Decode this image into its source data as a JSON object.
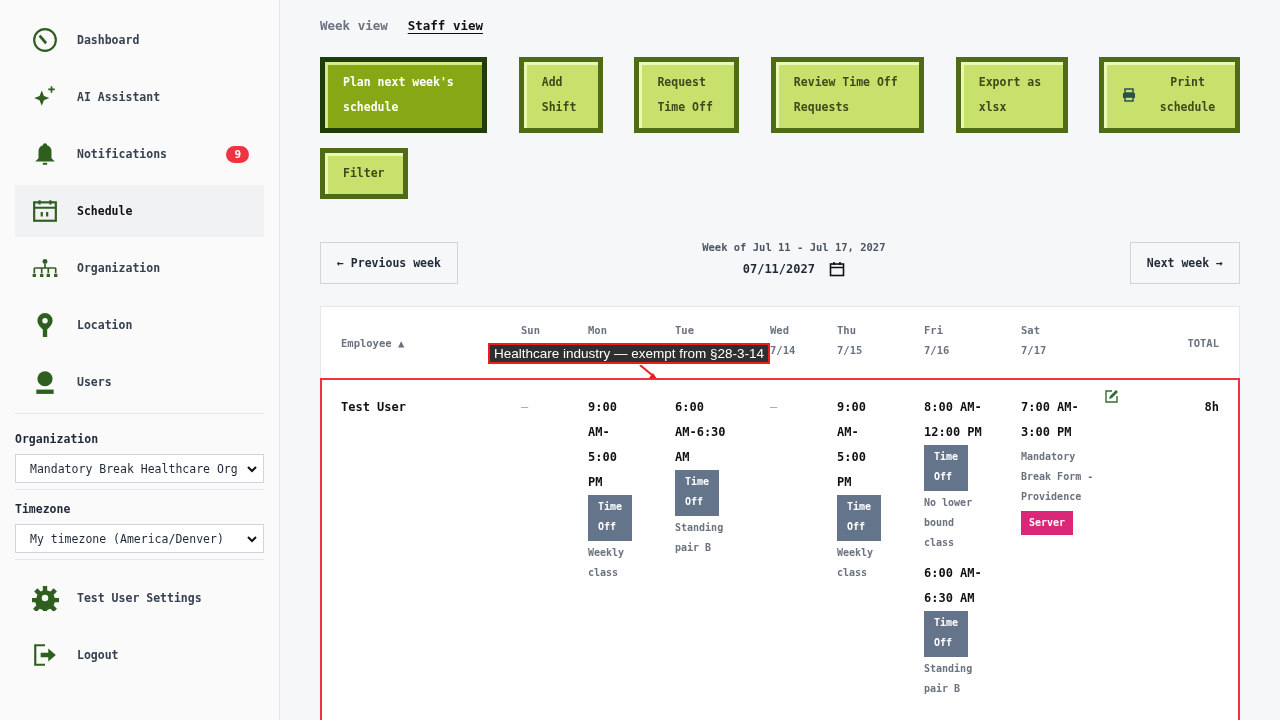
{
  "sidebar": {
    "items": [
      {
        "label": "Dashboard",
        "selected": false
      },
      {
        "label": "AI Assistant",
        "selected": false
      },
      {
        "label": "Notifications",
        "selected": false,
        "badge": "9"
      },
      {
        "label": "Schedule",
        "selected": true
      },
      {
        "label": "Organization",
        "selected": false
      },
      {
        "label": "Location",
        "selected": false
      },
      {
        "label": "Users",
        "selected": false
      }
    ],
    "selects": [
      {
        "label": "Organization",
        "value": "Mandatory Break Healthcare Org"
      },
      {
        "label": "Timezone",
        "value": "My timezone (America/Denver)"
      }
    ],
    "footer_items": [
      {
        "label": "Test User Settings"
      },
      {
        "label": "Logout"
      }
    ]
  },
  "view_tabs": [
    {
      "label": "Week view",
      "selected": false
    },
    {
      "label": "Staff view",
      "selected": true
    }
  ],
  "actions": [
    {
      "label": "Plan next week's schedule",
      "kind": "primary"
    },
    {
      "label": "Add Shift",
      "kind": "secondary"
    },
    {
      "label": "Request Time Off",
      "kind": "secondary"
    },
    {
      "label": "Review Time Off Requests",
      "kind": "secondary"
    },
    {
      "label": "Export as xlsx",
      "kind": "secondary"
    },
    {
      "label": "Print schedule",
      "kind": "print"
    },
    {
      "label": "Filter",
      "kind": "secondary"
    }
  ],
  "week_nav": {
    "previous": "← Previous week",
    "caption": "Week of Jul 11 - Jul 17, 2027",
    "date": "07/11/2027",
    "next": "Next week →"
  },
  "table": {
    "columns": [
      {
        "label": "Employee ▲"
      },
      {
        "label": "Sun"
      },
      {
        "label": "Mon"
      },
      {
        "label": "Tue"
      },
      {
        "label": "Wed",
        "date": "7/14"
      },
      {
        "label": "Thu",
        "date": "7/15"
      },
      {
        "label": "Fri",
        "date": "7/16"
      },
      {
        "label": "Sat",
        "date": "7/17"
      },
      {
        "label": "TOTAL"
      }
    ],
    "rows": [
      {
        "employee": "Test User",
        "highlighted": true,
        "total": "8h",
        "days": [
          {
            "empty": "—"
          },
          {
            "shifts": [
              {
                "time": "9:00 AM-5:00 PM",
                "badge": "Time Off",
                "note": "Weekly class"
              }
            ]
          },
          {
            "shifts": [
              {
                "time": "6:00 AM-6:30 AM",
                "badge": "Time Off",
                "note": "Standing pair B"
              }
            ]
          },
          {
            "empty": "—"
          },
          {
            "shifts": [
              {
                "time": "9:00 AM-5:00 PM",
                "badge": "Time Off",
                "note": "Weekly class"
              }
            ]
          },
          {
            "shifts": [
              {
                "time": "8:00 AM-12:00 PM",
                "badge": "Time Off",
                "note": "No lower bound class"
              },
              {
                "time": "6:00 AM-6:30 AM",
                "badge": "Time Off",
                "note": "Standing pair B"
              }
            ]
          },
          {
            "shifts": [
              {
                "time": "7:00 AM-3:00 PM",
                "note": "Mandatory Break Form - Providence",
                "role": "Server",
                "color": "#db2777"
              }
            ],
            "editable": true
          }
        ]
      }
    ]
  },
  "annotation": {
    "text": "Healthcare industry — exempt from §28-3-14"
  }
}
